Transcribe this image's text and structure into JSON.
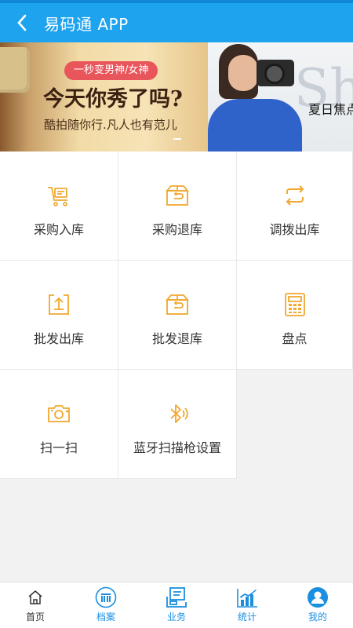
{
  "header": {
    "title": "易码通 APP"
  },
  "banner": {
    "slide1": {
      "pill": "一秒变男神/女神",
      "headline": "今天你秀了吗?",
      "subline": "酷拍随你行.凡人也有范儿"
    },
    "slide2": {
      "big_letters": "Sh",
      "caption": "夏日焦点"
    }
  },
  "grid": {
    "items": [
      {
        "label": "采购入库",
        "icon": "cart-icon"
      },
      {
        "label": "采购退库",
        "icon": "box-return-icon"
      },
      {
        "label": "调拨出库",
        "icon": "transfer-arrows-icon"
      },
      {
        "label": "批发出库",
        "icon": "upload-tray-icon"
      },
      {
        "label": "批发退库",
        "icon": "box-return-icon"
      },
      {
        "label": "盘点",
        "icon": "calculator-icon"
      },
      {
        "label": "扫一扫",
        "icon": "camera-scan-icon"
      },
      {
        "label": "蓝牙扫描枪设置",
        "icon": "bluetooth-icon"
      }
    ]
  },
  "tabbar": {
    "items": [
      {
        "label": "首页",
        "icon": "home-icon"
      },
      {
        "label": "档案",
        "icon": "archive-icon"
      },
      {
        "label": "业务",
        "icon": "business-icon"
      },
      {
        "label": "统计",
        "icon": "chart-icon"
      },
      {
        "label": "我的",
        "icon": "user-icon"
      }
    ]
  },
  "colors": {
    "header": "#1ea3ef",
    "accent_icon": "#f0a830",
    "tab_active": "#1a8fe0",
    "tab_inactive": "#333333"
  }
}
